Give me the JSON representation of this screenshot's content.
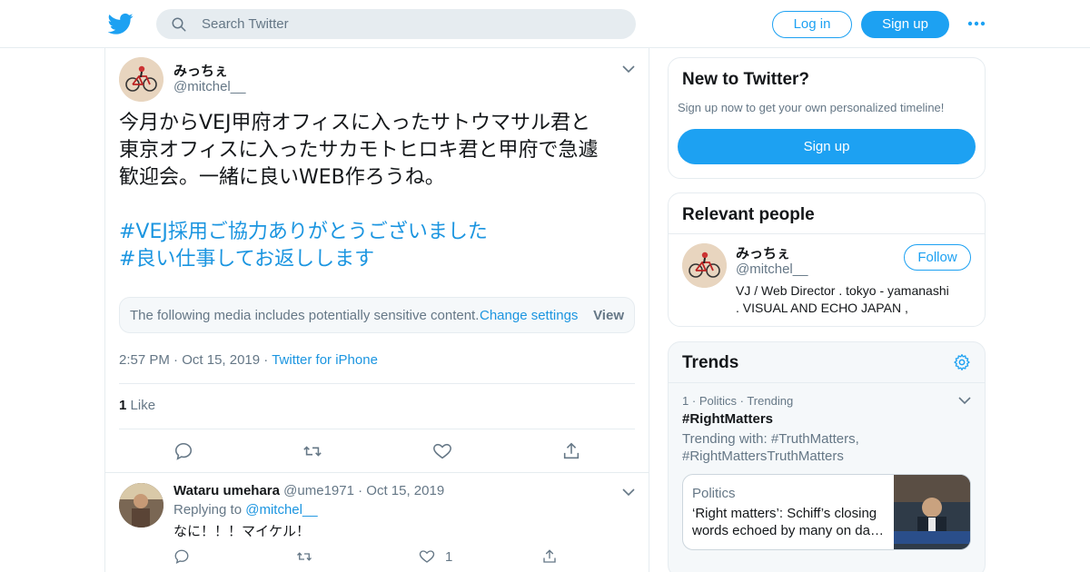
{
  "colors": {
    "brand": "#1da1f2",
    "link": "#1b95e0",
    "muted": "#657786",
    "text": "#14171a",
    "border": "#e6ecf0"
  },
  "header": {
    "logo_icon": "twitter-bird-icon",
    "search_placeholder": "Search Twitter",
    "login_label": "Log in",
    "signup_label": "Sign up",
    "more_icon": "more-dots-icon"
  },
  "tweet": {
    "author_name": "みっちぇ",
    "author_handle": "@mitchel__",
    "text_lines": [
      "今月からVEJ甲府オフィスに入ったサトウマサル君と",
      "東京オフィスに入ったサカモトヒロキ君と甲府で急遽",
      "歓迎会。一緒に良いWEB作ろうね。"
    ],
    "hashtags": [
      "#VEJ採用ご協力ありがとうございました",
      "#良い仕事してお返しします"
    ],
    "sensitive_message": "The following media includes potentially sensitive content.",
    "sensitive_link": "Change settings",
    "sensitive_view": "View",
    "time": "2:57 PM",
    "date": "Oct 15, 2019",
    "source": "Twitter for iPhone",
    "like_count": "1",
    "like_label": "Like",
    "actions": [
      "reply-icon",
      "retweet-icon",
      "like-icon",
      "share-icon"
    ]
  },
  "reply": {
    "author_name": "Wataru umehara",
    "author_handle": "@ume1971",
    "date": "Oct 15, 2019",
    "replying_label": "Replying to",
    "replying_to": "@mitchel__",
    "text": "なに！！！マイケル！",
    "like_count": "1"
  },
  "sidebar": {
    "new_to_twitter": {
      "title": "New to Twitter?",
      "subtitle": "Sign up now to get your own personalized timeline!",
      "signup_label": "Sign up"
    },
    "relevant_people": {
      "title": "Relevant people",
      "name": "みっちぇ",
      "handle": "@mitchel__",
      "follow_label": "Follow",
      "bio_line1": "VJ / Web Director . tokyo - yamanashi",
      "bio_line2": ". VISUAL AND ECHO JAPAN ,"
    },
    "trends": {
      "title": "Trends",
      "rank": "1",
      "category": "Politics",
      "status": "Trending",
      "name": "#RightMatters",
      "with_line1": "Trending with: #TruthMatters,",
      "with_line2": "#RightMattersTruthMatters",
      "news_category": "Politics",
      "news_line1": "‘Right matters’: Schiff’s closing",
      "news_line2": "words echoed by many on da…"
    }
  }
}
